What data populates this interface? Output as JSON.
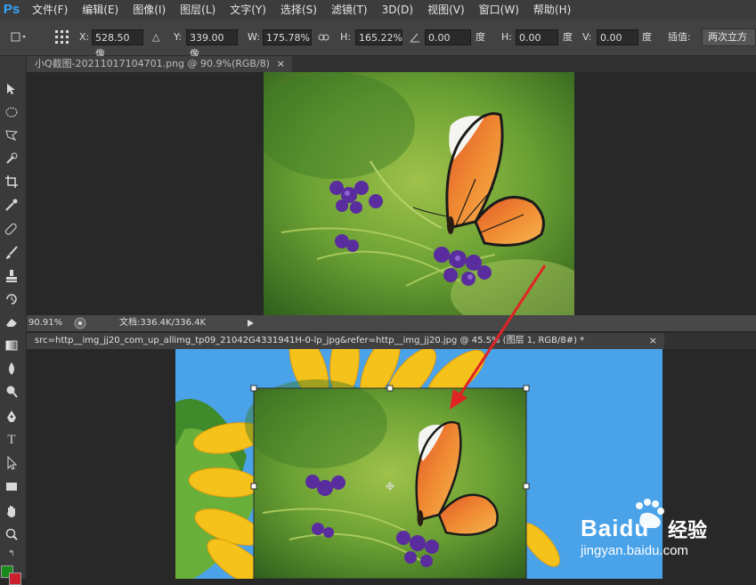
{
  "app": {
    "logo": "Ps"
  },
  "menu": [
    "文件(F)",
    "编辑(E)",
    "图像(I)",
    "图层(L)",
    "文字(Y)",
    "选择(S)",
    "滤镜(T)",
    "3D(D)",
    "视图(V)",
    "窗口(W)",
    "帮助(H)"
  ],
  "options": {
    "x_label": "X:",
    "x_value": "528.50 像",
    "delta_symbol": "△",
    "y_label": "Y:",
    "y_value": "339.00 像",
    "w_label": "W:",
    "w_value": "175.78%",
    "h_label": "H:",
    "h_value": "165.22%",
    "angle_value": "0.00",
    "angle_unit": "度",
    "hskew_label": "H:",
    "hskew_value": "0.00",
    "hskew_unit": "度",
    "vskew_label": "V:",
    "vskew_value": "0.00",
    "vskew_unit": "度",
    "interp_label": "插值:",
    "interp_value": "两次立方"
  },
  "doc1": {
    "tab_title": "小Q截图-20211017104701.png @ 90.9%(RGB/8)",
    "close": "×",
    "zoom": "90.91%",
    "doc_size": "文档:336.4K/336.4K"
  },
  "doc2": {
    "tab_title": "src=http__img_jj20_com_up_allimg_tp09_21042G4331941H-0-lp_jpg&refer=http__img_jj20.jpg @ 45.5% (图层 1, RGB/8#) *",
    "close": "×"
  },
  "watermark": {
    "brand": "Baidu",
    "brand_cn": "经验",
    "url": "jingyan.baidu.com"
  },
  "colors": {
    "foreground": "#1a8a1a",
    "background": "#cc1f2d",
    "arrow": "#e02424",
    "sky": "#4aa2e8",
    "ps_blue": "#31a8ff"
  },
  "tools": [
    "move-tool",
    "marquee-tool",
    "lasso-tool",
    "quick-select-tool",
    "crop-tool",
    "eyedropper-tool",
    "healing-brush-tool",
    "brush-tool",
    "clone-stamp-tool",
    "history-brush-tool",
    "eraser-tool",
    "gradient-tool",
    "blur-tool",
    "dodge-tool",
    "pen-tool",
    "type-tool",
    "path-select-tool",
    "shape-tool",
    "hand-tool",
    "zoom-tool"
  ]
}
